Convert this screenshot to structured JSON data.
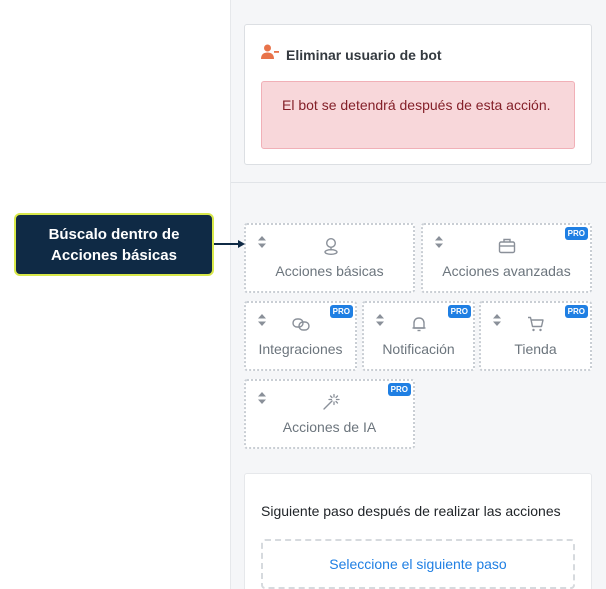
{
  "action": {
    "icon": "user-minus-icon",
    "title": "Eliminar usuario de bot",
    "alert": "El bot se detendrá después de esta acción."
  },
  "tiles": [
    {
      "label": "Acciones básicas",
      "icon": "location-pin-icon",
      "pro": false
    },
    {
      "label": "Acciones avanzadas",
      "icon": "toolbox-icon",
      "pro": true
    },
    {
      "label": "Integraciones",
      "icon": "link-icon",
      "pro": true
    },
    {
      "label": "Notificación",
      "icon": "bell-icon",
      "pro": true
    },
    {
      "label": "Tienda",
      "icon": "cart-icon",
      "pro": true
    },
    {
      "label": "Acciones de IA",
      "icon": "magic-wand-icon",
      "pro": true
    }
  ],
  "pro_badge": "PRO",
  "next_step": {
    "text": "Siguiente paso después de realizar las acciones",
    "button": "Seleccione el siguiente paso"
  },
  "callout": {
    "text": "Búscalo dentro de Acciones básicas"
  },
  "colors": {
    "accent": "#1f7fe3",
    "user_icon": "#e8734a",
    "alert_bg": "#f8d7da",
    "alert_text": "#842029",
    "callout_bg": "#0f2a45",
    "callout_border": "#d8e84a"
  }
}
